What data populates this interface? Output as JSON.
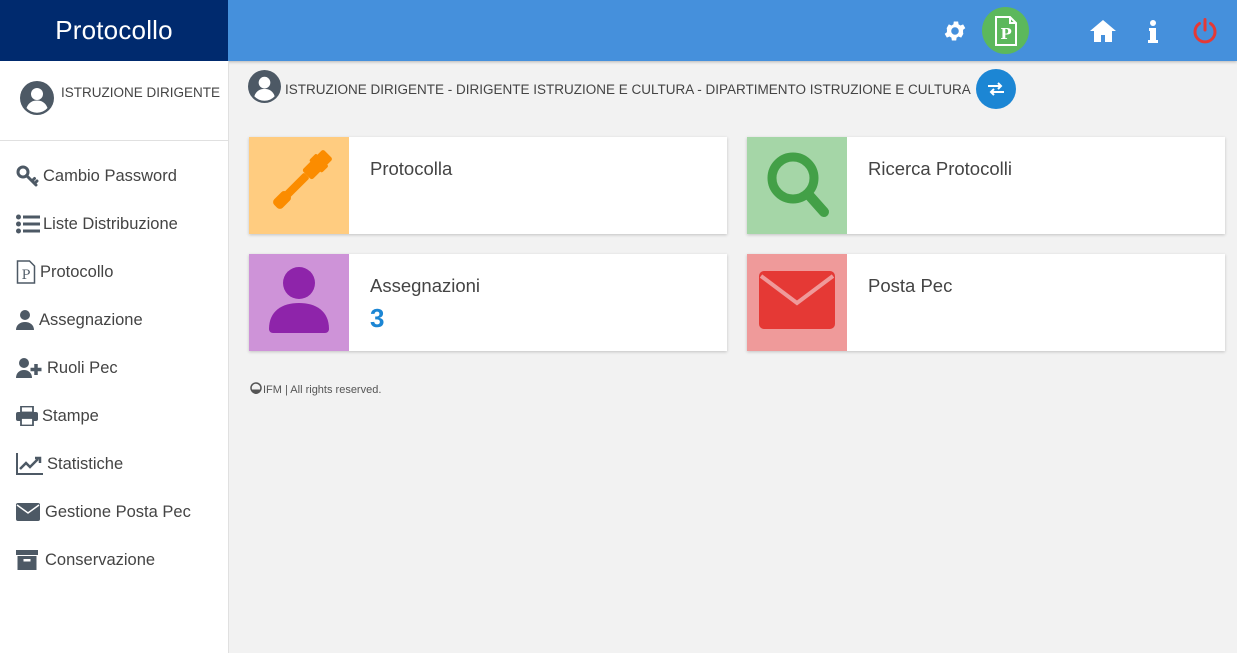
{
  "app": {
    "title": "Protocollo"
  },
  "topbar": {
    "icons": [
      "gear-icon",
      "protocol-p-icon",
      "home-icon",
      "info-icon",
      "power-icon"
    ],
    "colors": {
      "bar": "#4590dc",
      "brand": "#002a6e",
      "p_badge": "#5cb85c",
      "power": "#e53935"
    }
  },
  "sidebar": {
    "user": {
      "name": "ISTRUZIONE DIRIGENTE",
      "icon": "user-circle-icon"
    },
    "items": [
      {
        "label": "Cambio Password",
        "icon": "key-icon"
      },
      {
        "label": "Liste Distribuzione",
        "icon": "list-icon"
      },
      {
        "label": "Protocollo",
        "icon": "protocol-p-icon"
      },
      {
        "label": "Assegnazione",
        "icon": "user-icon"
      },
      {
        "label": "Ruoli Pec",
        "icon": "user-plus-icon"
      },
      {
        "label": "Stampe",
        "icon": "printer-icon"
      },
      {
        "label": "Statistiche",
        "icon": "line-chart-icon"
      },
      {
        "label": "Gestione Posta Pec",
        "icon": "envelope-icon"
      },
      {
        "label": "Conservazione",
        "icon": "archive-icon"
      }
    ]
  },
  "main": {
    "breadcrumb": "ISTRUZIONE DIRIGENTE - DIRIGENTE ISTRUZIONE E CULTURA - DIPARTIMENTO ISTRUZIONE E CULTURA",
    "cards": [
      {
        "title": "Protocolla",
        "icon": "gavel-icon",
        "tile_color": "#ffcc80",
        "icon_color": "#fb8c00"
      },
      {
        "title": "Ricerca Protocolli",
        "icon": "search-icon",
        "tile_color": "#a5d6a7",
        "icon_color": "#43a047"
      },
      {
        "title": "Assegnazioni",
        "count": "3",
        "icon": "user-icon",
        "tile_color": "#ce93d8",
        "icon_color": "#8e24aa"
      },
      {
        "title": "Posta Pec",
        "icon": "envelope-icon",
        "tile_color": "#ef9a9a",
        "icon_color": "#e53935"
      }
    ]
  },
  "footer": {
    "text": "IFM | All rights reserved."
  }
}
